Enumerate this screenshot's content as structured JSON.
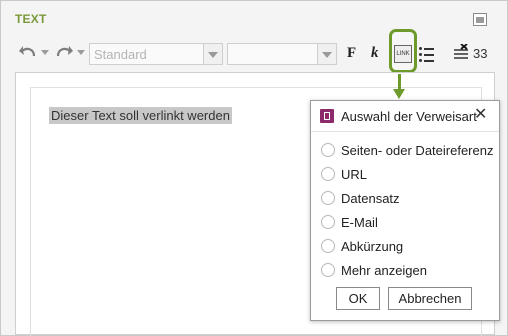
{
  "panel": {
    "title": "TEXT"
  },
  "toolbar": {
    "style_select_value": "Standard",
    "second_select_value": "",
    "bold_label": "F",
    "italic_label": "k",
    "link_label": "LINK",
    "char_count": "33"
  },
  "editor": {
    "selected_text": "Dieser Text soll verlinkt werden"
  },
  "popup": {
    "title": "Auswahl der Verweisart",
    "options": [
      {
        "label": "Seiten- oder Dateireferenz",
        "checked": false
      },
      {
        "label": "URL",
        "checked": false
      },
      {
        "label": "Datensatz",
        "checked": false
      },
      {
        "label": "E-Mail",
        "checked": false
      },
      {
        "label": "Abkürzung",
        "checked": false
      },
      {
        "label": "Mehr anzeigen",
        "checked": false
      }
    ],
    "ok_label": "OK",
    "cancel_label": "Abbrechen"
  },
  "colors": {
    "accent_green": "#6e9a2c",
    "title_green": "#7a9a3a",
    "popup_icon": "#8c2b6b",
    "selection": "#c8c8c8"
  },
  "icons": [
    "undo-icon",
    "redo-icon",
    "link-icon",
    "list-icon",
    "clear-format-icon",
    "restore-icon",
    "close-icon",
    "link-type-icon"
  ]
}
